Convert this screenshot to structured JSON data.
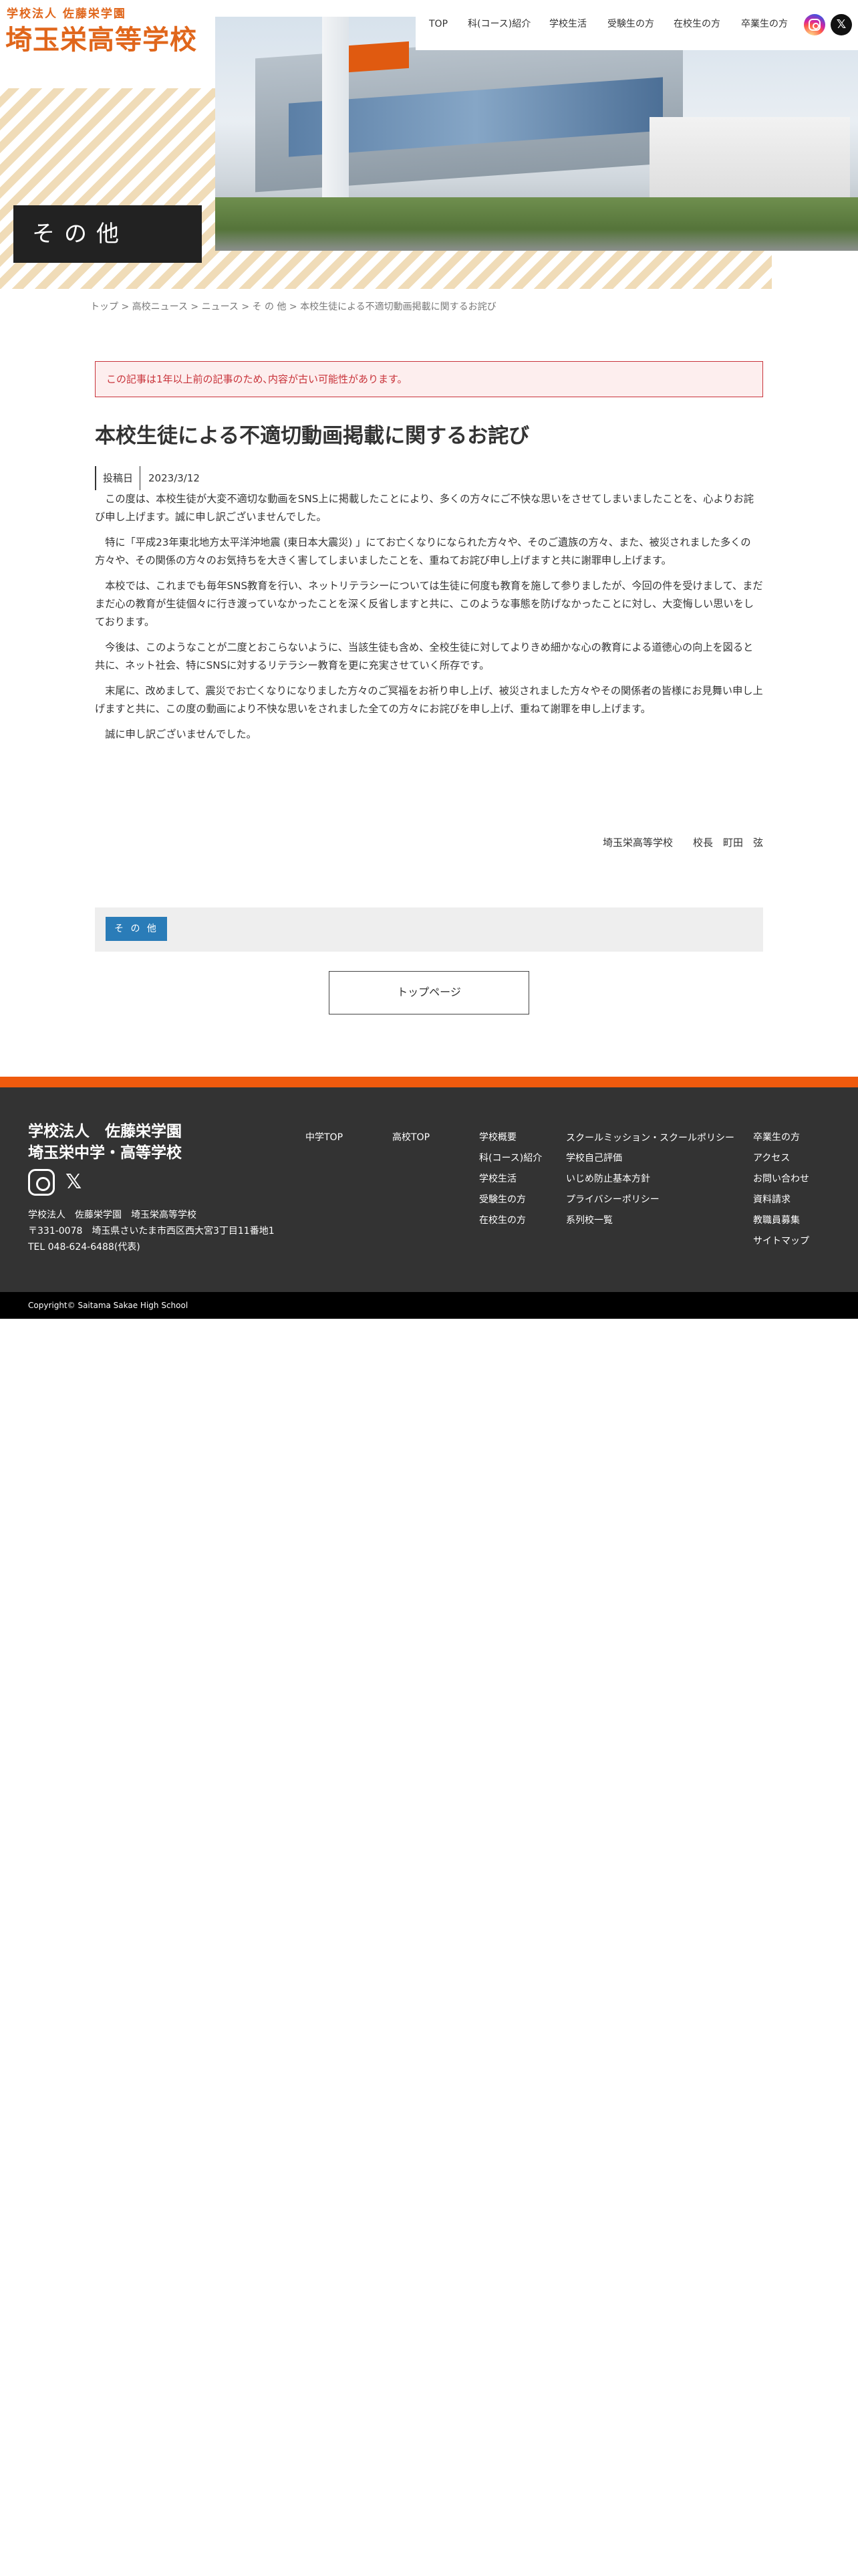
{
  "header": {
    "logo_sub": "学校法人 佐藤栄学園",
    "logo_main": "埼玉栄高等学校",
    "nav": [
      {
        "label": "TOP"
      },
      {
        "label": "科(コース)紹介"
      },
      {
        "label": "学校生活"
      },
      {
        "label": "受験生の方"
      },
      {
        "label": "在校生の方"
      },
      {
        "label": "卒業生の方"
      }
    ],
    "sns": {
      "instagram_icon": "instagram-icon",
      "x_icon": "x-icon",
      "x_label": "𝕏"
    }
  },
  "hero": {
    "page_title": "その他"
  },
  "breadcrumb": {
    "items": [
      "トップ",
      "高校ニュース",
      "ニュース",
      "そ の 他",
      "本校生徒による不適切動画掲載に関するお詫び"
    ],
    "separator": " > "
  },
  "notice": {
    "text": "この記事は1年以上前の記事のため､内容が古い可能性があります。"
  },
  "article": {
    "title": "本校生徒による不適切動画掲載に関するお詫び",
    "date_label": "投稿日",
    "date": "2023/3/12",
    "paragraphs": [
      "この度は、本校生徒が大変不適切な動画をSNS上に掲載したことにより、多くの方々にご不快な思いをさせてしまいましたことを、心よりお詫び申し上げます。誠に申し訳ございませんでした。",
      "特に「平成23年東北地方太平洋沖地震 (東日本大震災) 」にてお亡くなりになられた方々や、そのご遺族の方々、また、被災されました多くの方々や、その関係の方々のお気持ちを大きく害してしまいましたことを、重ねてお詫び申し上げますと共に謝罪申し上げます。",
      "本校では、これまでも毎年SNS教育を行い、ネットリテラシーについては生徒に何度も教育を施して参りましたが、今回の件を受けまして、まだまだ心の教育が生徒個々に行き渡っていなかったことを深く反省しますと共に、このような事態を防げなかったことに対し、大変悔しい思いをしております。",
      "今後は、このようなことが二度とおこらないように、当該生徒も含め、全校生徒に対してよりきめ細かな心の教育による道徳心の向上を図ると共に、ネット社会、特にSNSに対するリテラシー教育を更に充実させていく所存です。",
      "末尾に、改めまして、震災でお亡くなりになりました方々のご冥福をお祈り申し上げ、被災されました方々やその関係者の皆様にお見舞い申し上げますと共に、この度の動画により不快な思いをされました全ての方々にお詫びを申し上げ、重ねて謝罪を申し上げます。",
      "誠に申し訳ございませんでした。"
    ],
    "signature": "埼玉栄高等学校　　校長　町田　弦",
    "category": "そ の 他"
  },
  "top_page_button": "トップページ",
  "footer": {
    "name": "学校法人　佐藤栄学園\n埼玉栄中学・高等学校",
    "x_label": "𝕏",
    "address_lines": [
      "学校法人　佐藤栄学園　埼玉栄高等学校",
      "〒331-0078　埼玉県さいたま市西区西大宮3丁目11番地1",
      "TEL 048-624-6488(代表)"
    ],
    "col1": [
      "中学TOP"
    ],
    "col2": [
      "高校TOP"
    ],
    "col3": [
      "学校概要",
      "科(コース)紹介",
      "学校生活",
      "受験生の方",
      "在校生の方"
    ],
    "col4": [
      "スクールミッション・スクールポリシー",
      "学校自己評価",
      "いじめ防止基本方針",
      "プライバシーポリシー",
      "系列校一覧"
    ],
    "col5": [
      "卒業生の方",
      "アクセス",
      "お問い合わせ",
      "資料請求",
      "教職員募集",
      "サイトマップ"
    ],
    "copyright": "Copyright© Saitama Sakae High School"
  },
  "colors": {
    "accent": "#ef5a0d",
    "logo": "#e0661b",
    "notice": "#c8333a",
    "tag": "#2a7cb8",
    "footer_bg": "#333333"
  }
}
